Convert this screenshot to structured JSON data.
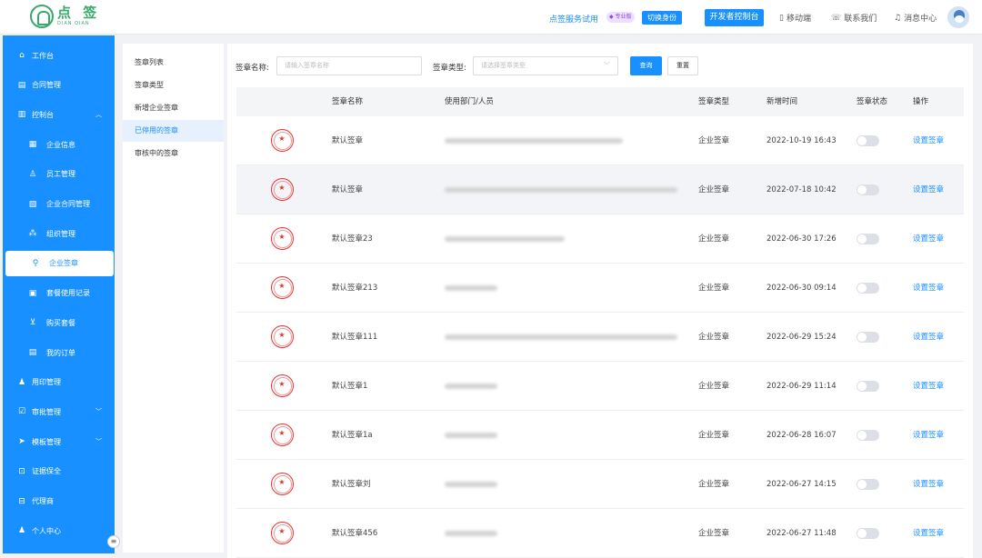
{
  "header": {
    "logo_cn": "点 签",
    "logo_en": "DIAN QIAN",
    "trial_text": "点签服务试用",
    "pro_badge": "专业版",
    "switch_identity": "切换身份",
    "dev_console": "开发者控制台",
    "nav": [
      {
        "icon": "mobile-icon",
        "glyph": "▯",
        "label": "移动端"
      },
      {
        "icon": "phone-icon",
        "glyph": "☏",
        "label": "联系我们"
      },
      {
        "icon": "bell-icon",
        "glyph": "♫",
        "label": "消息中心"
      }
    ]
  },
  "sidebar": {
    "items": [
      {
        "label": "工作台",
        "icon": "home-icon",
        "glyph": "⌂",
        "sub": false
      },
      {
        "label": "合同管理",
        "icon": "clipboard-icon",
        "glyph": "▤",
        "sub": false
      },
      {
        "label": "控制台",
        "icon": "chart-icon",
        "glyph": "▥",
        "sub": false,
        "chevron": "︿"
      },
      {
        "label": "企业信息",
        "icon": "building-icon",
        "glyph": "▦",
        "sub": true
      },
      {
        "label": "员工管理",
        "icon": "user-icon",
        "glyph": "♙",
        "sub": true
      },
      {
        "label": "企业合同管理",
        "icon": "document-icon",
        "glyph": "▧",
        "sub": true
      },
      {
        "label": "组织管理",
        "icon": "org-icon",
        "glyph": "⁂",
        "sub": true
      },
      {
        "label": "企业签章",
        "icon": "seal-icon",
        "glyph": "⚲",
        "sub": true,
        "active": true
      },
      {
        "label": "套餐使用记录",
        "icon": "record-icon",
        "glyph": "▣",
        "sub": true
      },
      {
        "label": "购买套餐",
        "icon": "cart-icon",
        "glyph": "⊻",
        "sub": true
      },
      {
        "label": "我的订单",
        "icon": "order-icon",
        "glyph": "▤",
        "sub": true
      },
      {
        "label": "用印管理",
        "icon": "stamp-icon",
        "glyph": "♟",
        "sub": false
      },
      {
        "label": "审批管理",
        "icon": "approve-icon",
        "glyph": "☑",
        "sub": false,
        "chevron": "﹀"
      },
      {
        "label": "模板管理",
        "icon": "send-icon",
        "glyph": "➤",
        "sub": false,
        "chevron": "﹀"
      },
      {
        "label": "证据保全",
        "icon": "lock-icon",
        "glyph": "⊡",
        "sub": false
      },
      {
        "label": "代理商",
        "icon": "briefcase-icon",
        "glyph": "⊟",
        "sub": false
      },
      {
        "label": "个人中心",
        "icon": "person-icon",
        "glyph": "♟",
        "sub": false
      }
    ],
    "collapse_glyph": "≡"
  },
  "submenu": {
    "items": [
      {
        "label": "签章列表",
        "active": false
      },
      {
        "label": "签章类型",
        "active": false
      },
      {
        "label": "新增企业签章",
        "active": false
      },
      {
        "label": "已停用的签章",
        "active": true
      },
      {
        "label": "审核中的签章",
        "active": false
      }
    ]
  },
  "filters": {
    "name_label": "签章名称:",
    "name_placeholder": "请输入签章名称",
    "type_label": "签章类型:",
    "type_placeholder": "请选择签章类型",
    "type_caret": "﹀",
    "query_button": "查询",
    "reset_button": "重置"
  },
  "table": {
    "columns": [
      "签章名称",
      "使用部门/人员",
      "签章类型",
      "新增时间",
      "签章状态",
      "操作"
    ],
    "rows": [
      {
        "name": "默认签章",
        "dept": "",
        "type": "企业签章",
        "time": "2022-10-19 16:43",
        "enabled": false,
        "action": "设置签章"
      },
      {
        "name": "默认签章",
        "dept": "",
        "type": "企业签章",
        "time": "2022-07-18 10:42",
        "enabled": false,
        "action": "设置签章"
      },
      {
        "name": "默认签章23",
        "dept": "",
        "type": "企业签章",
        "time": "2022-06-30 17:26",
        "enabled": false,
        "action": "设置签章"
      },
      {
        "name": "默认签章213",
        "dept": "",
        "type": "企业签章",
        "time": "2022-06-30 09:14",
        "enabled": false,
        "action": "设置签章"
      },
      {
        "name": "默认签章111",
        "dept": "",
        "type": "企业签章",
        "time": "2022-06-29 15:24",
        "enabled": false,
        "action": "设置签章"
      },
      {
        "name": "默认签章1",
        "dept": "",
        "type": "企业签章",
        "time": "2022-06-29 11:14",
        "enabled": false,
        "action": "设置签章"
      },
      {
        "name": "默认签章1a",
        "dept": "",
        "type": "企业签章",
        "time": "2022-06-28 16:07",
        "enabled": false,
        "action": "设置签章"
      },
      {
        "name": "默认签章刘",
        "dept": "",
        "type": "企业签章",
        "time": "2022-06-27 14:15",
        "enabled": false,
        "action": "设置签章"
      },
      {
        "name": "默认签章456",
        "dept": "",
        "type": "企业签章",
        "time": "2022-06-27 11:48",
        "enabled": false,
        "action": "设置签章"
      }
    ],
    "seal_glyph": "★"
  },
  "colors": {
    "primary": "#1890ff",
    "seal_red": "#e03434",
    "logo_green": "#3aa86b"
  }
}
